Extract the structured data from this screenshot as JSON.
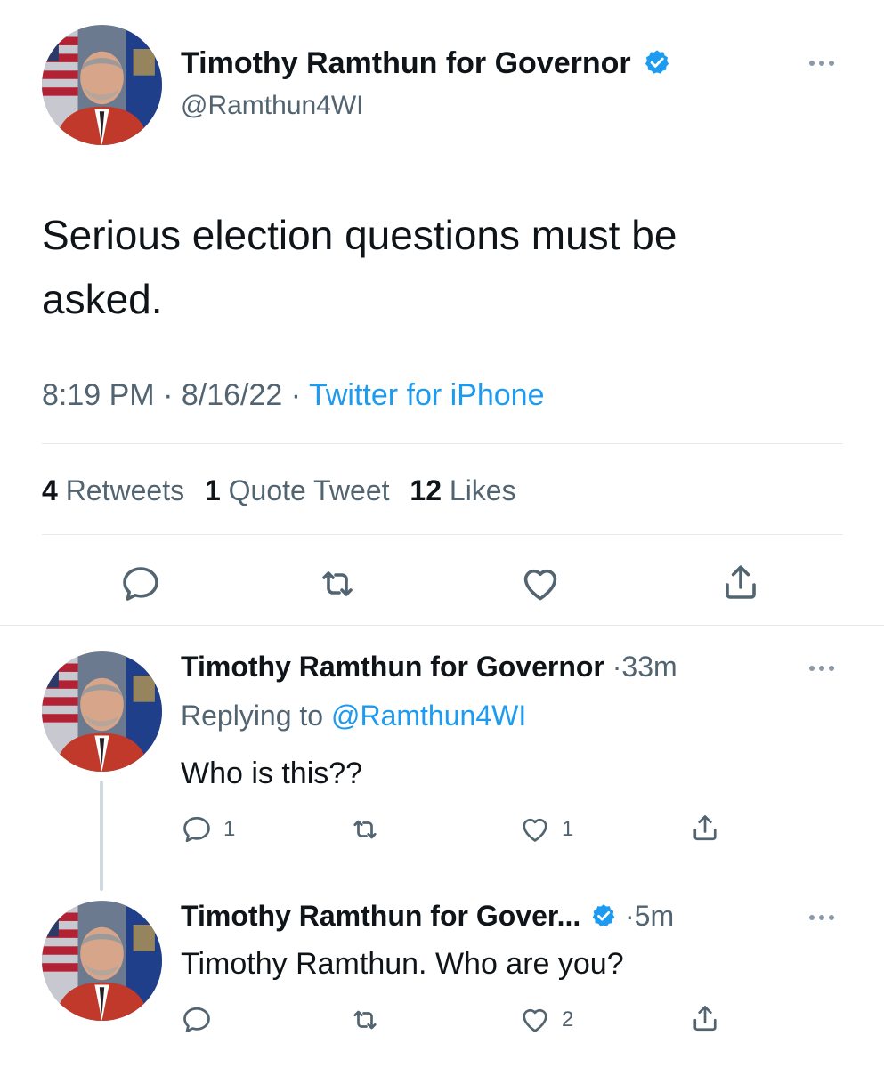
{
  "main_tweet": {
    "display_name": "Timothy Ramthun for Governor",
    "handle": "@Ramthun4WI",
    "text_line1": "Serious election questions must be",
    "text_line2": "asked.",
    "time": "8:19 PM",
    "date": "8/16/22",
    "source": "Twitter for iPhone",
    "separator": "·",
    "stats": {
      "retweets_count": "4",
      "retweets_label": "Retweets",
      "quotes_count": "1",
      "quotes_label": "Quote Tweet",
      "likes_count": "12",
      "likes_label": "Likes"
    },
    "verified": true
  },
  "replies": [
    {
      "display_name": "Timothy Ramthun for Governor",
      "time_ago": "33m",
      "replying_prefix": "Replying to",
      "replying_to": "@Ramthun4WI",
      "text": "Who is this??",
      "reply_count": "1",
      "retweet_count": "",
      "like_count": "1",
      "verified": false
    },
    {
      "display_name": "Timothy Ramthun for Gover...",
      "time_ago": "5m",
      "text": "Timothy Ramthun. Who are you?",
      "reply_count": "",
      "retweet_count": "",
      "like_count": "2",
      "verified": true
    }
  ],
  "icons": {
    "reply": "reply-icon",
    "retweet": "retweet-icon",
    "like": "heart-icon",
    "share": "share-icon",
    "more": "more-icon",
    "verified": "verified-badge-icon"
  },
  "colors": {
    "accent": "#1d9bf0",
    "text": "#0f1419",
    "secondary": "#536471",
    "divider": "#e6e9eb"
  }
}
